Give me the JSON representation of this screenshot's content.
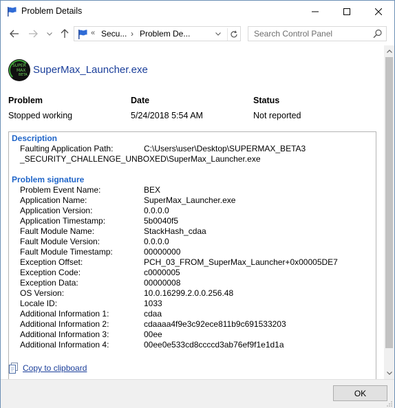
{
  "window": {
    "title": "Problem Details"
  },
  "nav": {
    "overflow": "«",
    "crumbs": [
      "Secu...",
      "Problem De..."
    ],
    "separator": "›",
    "search_placeholder": "Search Control Panel"
  },
  "app": {
    "logo_text": [
      "SUPER",
      "MAX",
      "BETA"
    ],
    "name": "SuperMax_Launcher.exe"
  },
  "summary": {
    "headers": [
      "Problem",
      "Date",
      "Status"
    ],
    "values": [
      "Stopped working",
      "5/24/2018 5:54 AM",
      "Not reported"
    ]
  },
  "description": {
    "title": "Description",
    "fault_label": "Faulting Application Path:",
    "fault_path_line1": "C:\\Users\\user\\Desktop\\SUPERMAX_BETA3",
    "fault_path_line2": "_SECURITY_CHALLENGE_UNBOXED\\SuperMax_Launcher.exe"
  },
  "signature": {
    "title": "Problem signature",
    "rows": [
      {
        "label": "Problem Event Name:",
        "value": "BEX"
      },
      {
        "label": "Application Name:",
        "value": "SuperMax_Launcher.exe"
      },
      {
        "label": "Application Version:",
        "value": "0.0.0.0"
      },
      {
        "label": "Application Timestamp:",
        "value": "5b0040f5"
      },
      {
        "label": "Fault Module Name:",
        "value": "StackHash_cdaa"
      },
      {
        "label": "Fault Module Version:",
        "value": "0.0.0.0"
      },
      {
        "label": "Fault Module Timestamp:",
        "value": "00000000"
      },
      {
        "label": "Exception Offset:",
        "value": "PCH_03_FROM_SuperMax_Launcher+0x00005DE7"
      },
      {
        "label": "Exception Code:",
        "value": "c0000005"
      },
      {
        "label": "Exception Data:",
        "value": "00000008"
      },
      {
        "label": "OS Version:",
        "value": "10.0.16299.2.0.0.256.48"
      },
      {
        "label": "Locale ID:",
        "value": "1033"
      },
      {
        "label": "Additional Information 1:",
        "value": "cdaa"
      },
      {
        "label": "Additional Information 2:",
        "value": "cdaaaa4f9e3c92ece811b9c691533203"
      },
      {
        "label": "Additional Information 3:",
        "value": "00ee"
      },
      {
        "label": "Additional Information 4:",
        "value": "00ee0e533cd8ccccd3ab76ef9f1e1d1a"
      }
    ]
  },
  "footer": {
    "copy_label": "Copy to clipboard",
    "ok_label": "OK"
  },
  "colors": {
    "link": "#1a3e9a",
    "section_title": "#1e64c8",
    "logo_green": "#6cd15a"
  }
}
